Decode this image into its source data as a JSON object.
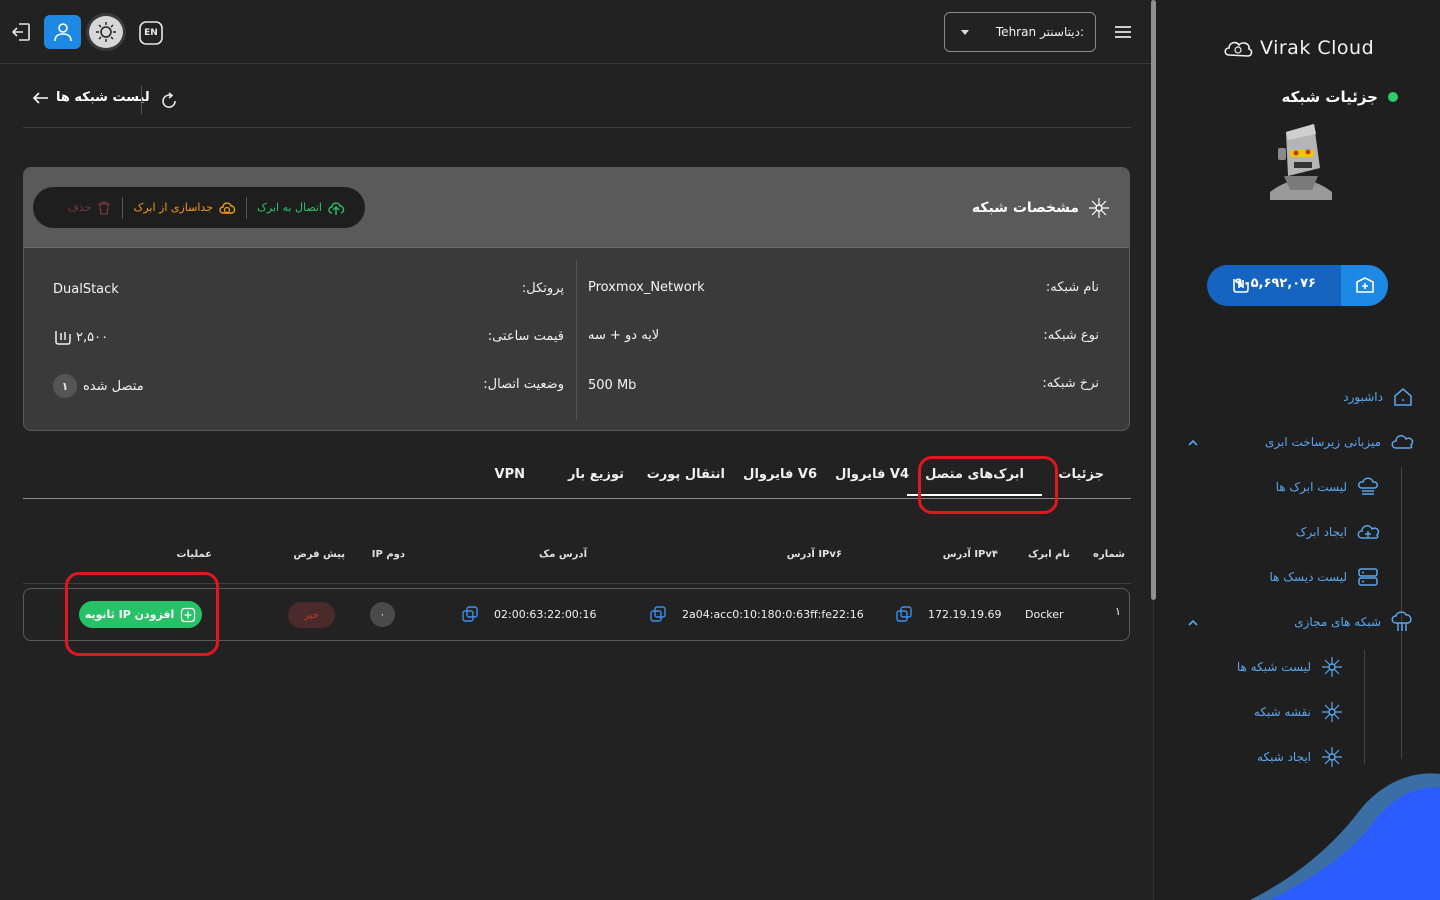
{
  "brand": {
    "logo_text": "Virak Cloud"
  },
  "topbar": {
    "lang": "EN",
    "datacenter_label": "دیتاسنتر:",
    "datacenter_value": "Tehran"
  },
  "sidebar": {
    "balance": "۹۰۵,۶۹۲,۰۷۶",
    "items": {
      "dashboard": "داشبورد",
      "cloud_hosting": "میزبانی زیرساخت ابری",
      "cloud_list": "لیست ابرک ها",
      "cloud_create": "ایجاد ابرک",
      "disk_list": "لیست دیسک ها",
      "virtual_networks": "شبکه های مجازی",
      "network_list": "لیست شبکه ها",
      "network_map": "نقشه شبکه",
      "network_create": "ایجاد شبکه"
    }
  },
  "header": {
    "title": "جزئیات شبکه",
    "back_label": "لیست شبکه ها"
  },
  "specs": {
    "title": "مشخصات شبکه",
    "actions": {
      "connect": "اتصال به ابرک",
      "disconnect": "جداسازی از ابرک",
      "delete": "حذف"
    },
    "fields": {
      "name_label": "نام شبکه:",
      "name_value": "Proxmox_Network",
      "type_label": "نوع شبکه:",
      "type_value": "لایه دو + سه",
      "rate_label": "نرخ شبکه:",
      "rate_value": "500 Mb",
      "protocol_label": "پروتکل:",
      "protocol_value": "DualStack",
      "price_label": "قیمت ساعتی:",
      "price_value": "۲,۵۰۰",
      "status_label": "وضعیت اتصال:",
      "status_value": "متصل شده",
      "status_count": "۱"
    }
  },
  "tabs": {
    "details": "جزئیات",
    "connected_clouds": "ابرک‌های متصل",
    "firewall_v4": "فایروال V4",
    "firewall_v6": "فایروال V6",
    "port_forward": "انتقال پورت",
    "load_balance": "توزیع بار",
    "vpn": "VPN"
  },
  "table": {
    "headers": {
      "number": "شماره",
      "cloud_name": "نام ابرک",
      "ipv4": "آدرس IPv۴",
      "ipv6": "آدرس IPv۶",
      "mac": "آدرس مک",
      "second_ip": "IP دوم",
      "default": "پیش فرض",
      "actions": "عملیات"
    },
    "rows": [
      {
        "number": "۱",
        "cloud_name": "Docker",
        "ipv4": "172.19.19.69",
        "ipv6": "2a04:acc0:10:180:0:63ff:fe22:16",
        "mac": "02:00:63:22:00:16",
        "second_ip": "۰",
        "default": "خیر",
        "action": "افزودن IP ثانویه"
      }
    ]
  },
  "colors": {
    "accent_blue": "#1e88e5",
    "success_green": "#27c267",
    "highlight_red": "#e0171f",
    "nav_link": "#5aa6ef"
  }
}
